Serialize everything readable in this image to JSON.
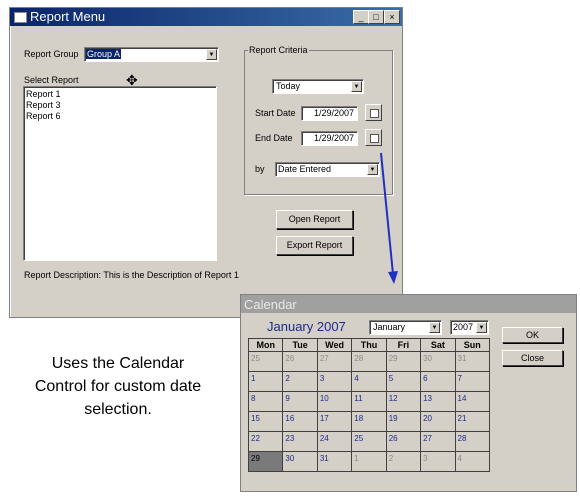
{
  "report_menu": {
    "title": "Report Menu",
    "report_group_label": "Report Group",
    "report_group_value": "Group A",
    "select_report_label": "Select Report",
    "reports": [
      "Report 1",
      "Report 3",
      "Report 6"
    ],
    "criteria_label": "Report Criteria",
    "period_value": "Today",
    "start_date_label": "Start Date",
    "start_date_value": "1/29/2007",
    "end_date_label": "End Date",
    "end_date_value": "1/29/2007",
    "by_label": "by",
    "by_value": "Date Entered",
    "open_button": "Open Report",
    "export_button": "Export Report",
    "description": "Report Description: This is the Description of Report 1"
  },
  "caption": [
    "Uses the Calendar",
    "Control for custom date",
    "selection."
  ],
  "calendar": {
    "title": "Calendar",
    "month_heading": "January 2007",
    "month_select": "January",
    "year_select": "2007",
    "ok_button": "OK",
    "close_button": "Close",
    "weekdays": [
      "Mon",
      "Tue",
      "Wed",
      "Thu",
      "Fri",
      "Sat",
      "Sun"
    ],
    "weeks": [
      [
        {
          "d": "25",
          "other": true
        },
        {
          "d": "26",
          "other": true
        },
        {
          "d": "27",
          "other": true
        },
        {
          "d": "28",
          "other": true
        },
        {
          "d": "29",
          "other": true
        },
        {
          "d": "30",
          "other": true
        },
        {
          "d": "31",
          "other": true
        }
      ],
      [
        {
          "d": "1"
        },
        {
          "d": "2"
        },
        {
          "d": "3"
        },
        {
          "d": "4"
        },
        {
          "d": "5"
        },
        {
          "d": "6"
        },
        {
          "d": "7"
        }
      ],
      [
        {
          "d": "8"
        },
        {
          "d": "9"
        },
        {
          "d": "10"
        },
        {
          "d": "11"
        },
        {
          "d": "12"
        },
        {
          "d": "13"
        },
        {
          "d": "14"
        }
      ],
      [
        {
          "d": "15"
        },
        {
          "d": "16"
        },
        {
          "d": "17"
        },
        {
          "d": "18"
        },
        {
          "d": "19"
        },
        {
          "d": "20"
        },
        {
          "d": "21"
        }
      ],
      [
        {
          "d": "22"
        },
        {
          "d": "23"
        },
        {
          "d": "24"
        },
        {
          "d": "25"
        },
        {
          "d": "26"
        },
        {
          "d": "27"
        },
        {
          "d": "28"
        }
      ],
      [
        {
          "d": "29",
          "selected": true
        },
        {
          "d": "30"
        },
        {
          "d": "31"
        },
        {
          "d": "1",
          "other": true
        },
        {
          "d": "2",
          "other": true
        },
        {
          "d": "3",
          "other": true
        },
        {
          "d": "4",
          "other": true
        }
      ]
    ]
  },
  "colors": {
    "title_bar": "#0a246a",
    "calendar_heading": "#1c2a8c",
    "arrow": "#2030c0"
  }
}
